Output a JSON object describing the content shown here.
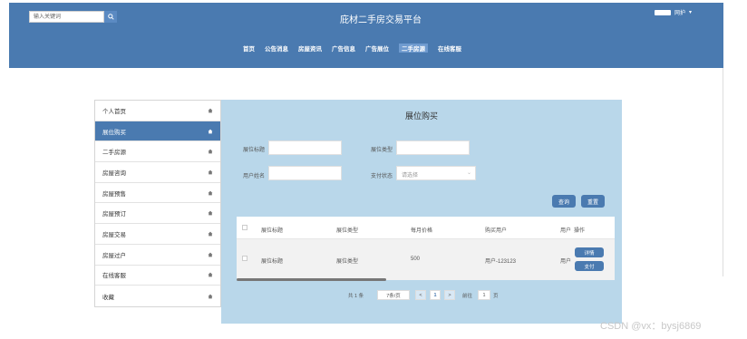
{
  "header": {
    "search_placeholder": "输入关键词",
    "site_title": "庇材二手房交易平台",
    "user_label": "网护",
    "nav": [
      "首页",
      "公告消息",
      "房屋资讯",
      "广告信息",
      "广告展位",
      "二手房源",
      "在线客服"
    ],
    "active_nav": 5
  },
  "sidebar": {
    "items": [
      "个人首页",
      "展位购买",
      "二手房源",
      "房屋咨询",
      "房屋预售",
      "房屋预订",
      "房屋交易",
      "房屋过户",
      "在线客服",
      "收藏"
    ],
    "active_index": 1
  },
  "main": {
    "title": "展位购买",
    "form": {
      "field1_label": "展位标题",
      "field2_label": "展位类型",
      "field3_label": "用户姓名",
      "field4_label": "支付状态",
      "select_placeholder": "请选择"
    },
    "buttons": {
      "query": "查询",
      "reset": "重置"
    },
    "table": {
      "headers": [
        "展位标题",
        "展位类型",
        "每月价格",
        "购买用户",
        "用户",
        "操作"
      ],
      "row": [
        "展位标题",
        "展位类型",
        "500",
        "用户-123123",
        "用户"
      ],
      "row_actions": [
        "详情",
        "支付"
      ]
    },
    "pager": {
      "total": "共 1 条",
      "page_size": "7条/页",
      "prev": "<",
      "current": "1",
      "next": ">",
      "goto_label": "前往",
      "goto_value": "1",
      "page_suffix": "页"
    }
  },
  "watermark": "CSDN @vx：bysj6869"
}
